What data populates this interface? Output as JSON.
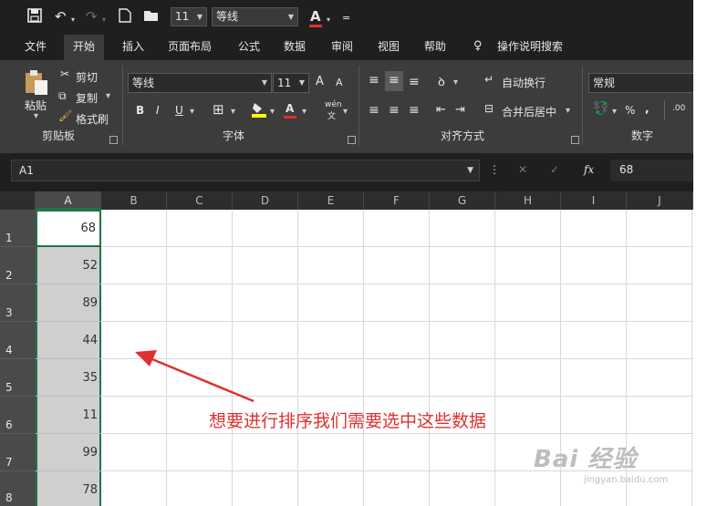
{
  "qat": {
    "font_size": "11",
    "font_name": "等线",
    "font_color_letter": "A",
    "more": "="
  },
  "tabs": [
    "文件",
    "开始",
    "插入",
    "页面布局",
    "公式",
    "数据",
    "审阅",
    "视图",
    "帮助",
    "操作说明搜索"
  ],
  "ribbon": {
    "clipboard": {
      "paste": "粘贴",
      "cut": "剪切",
      "copy": "复制",
      "format_painter": "格式刷",
      "group": "剪贴板"
    },
    "font": {
      "name": "等线",
      "size": "11",
      "bold": "B",
      "italic": "I",
      "underline": "U",
      "grow": "A",
      "shrink": "A",
      "phonetic_top": "wén",
      "phonetic_bottom": "文",
      "group": "字体"
    },
    "alignment": {
      "wrap_text": "自动换行",
      "merge_center": "合并后居中",
      "group": "对齐方式"
    },
    "number": {
      "format": "常规",
      "percent": "%",
      "comma": ",",
      "decimal": ".00",
      "group": "数字"
    }
  },
  "formula_bar": {
    "name_box": "A1",
    "fx": "fx",
    "value": "68"
  },
  "columns": [
    "A",
    "B",
    "C",
    "D",
    "E",
    "F",
    "G",
    "H",
    "I",
    "J"
  ],
  "rows": [
    {
      "row": "1",
      "a": "68"
    },
    {
      "row": "2",
      "a": "52"
    },
    {
      "row": "3",
      "a": "89"
    },
    {
      "row": "4",
      "a": "44"
    },
    {
      "row": "5",
      "a": "35"
    },
    {
      "row": "6",
      "a": "11"
    },
    {
      "row": "7",
      "a": "99"
    },
    {
      "row": "8",
      "a": "78"
    }
  ],
  "annotation": "想要进行排序我们需要选中这些数据",
  "watermark": {
    "brand": "Bai 经验",
    "url": "jingyan.baidu.com"
  },
  "colors": {
    "selection": "#217346",
    "annotation": "#e0302f"
  }
}
